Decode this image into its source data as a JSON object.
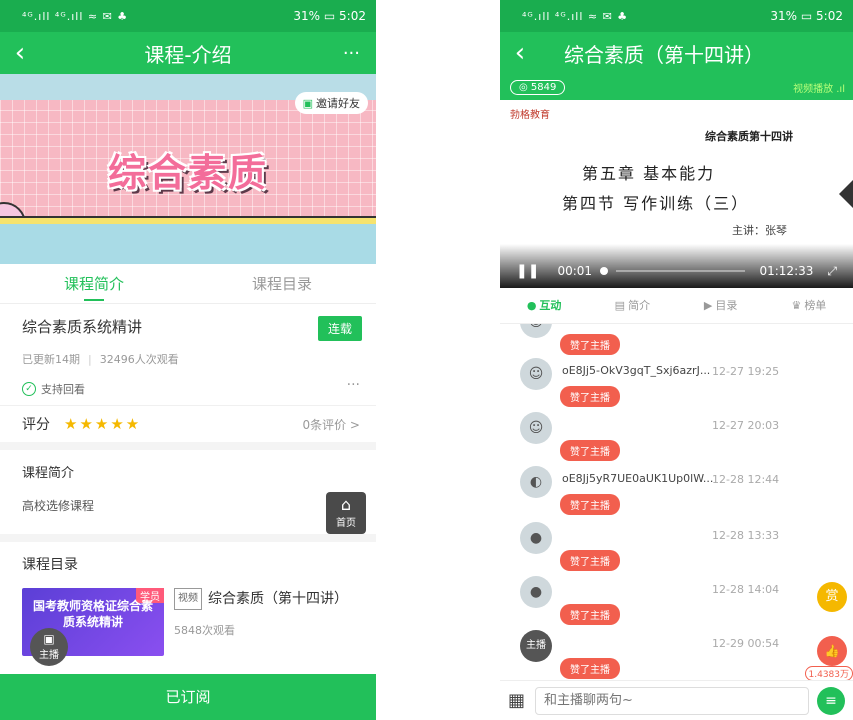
{
  "left": {
    "status": {
      "signal": "⁴ᴳ.ıll ⁴ᴳ.ıll ≈ ✉ ♣",
      "battery": "31%",
      "time": "5:02"
    },
    "nav": {
      "title": "课程-介绍",
      "more": "···"
    },
    "banner": {
      "title": "综合素质",
      "invite": "邀请好友"
    },
    "tabs": [
      "课程简介",
      "课程目录"
    ],
    "course": {
      "name": "综合素质系统精讲",
      "badge": "连载",
      "updated": "已更新14期",
      "views": "32496人次观看",
      "replay": "支持回看",
      "more": "···"
    },
    "rating": {
      "label": "评分",
      "stars": "★★★★★",
      "count": "0条评价 >"
    },
    "intro": {
      "heading": "课程简介",
      "text": "高校选修课程"
    },
    "home": {
      "label": "首页"
    },
    "catalog": {
      "heading": "课程目录",
      "lesson": {
        "thumb_tag": "学员",
        "thumb_title": "国考教师资格证综合素质系统精讲",
        "kind": "视频",
        "title": "综合素质（第十四讲）",
        "views": "5848次观看"
      }
    },
    "anchor": {
      "label": "主播"
    },
    "subscribe": "已订阅"
  },
  "right": {
    "status": {
      "signal": "⁴ᴳ.ıll ⁴ᴳ.ıll ≈ ✉ ♣",
      "battery": "31%",
      "time": "5:02"
    },
    "nav": {
      "title": "综合素质（第十四讲）"
    },
    "viewer_count": "◎ 5849",
    "play_mode": "视频播放 .ıl",
    "video": {
      "logo": "勃格教育",
      "slide_title": "综合素质第十四讲",
      "chapter": "第五章  基本能力",
      "section": "第四节  写作训练（三）",
      "lecturer": "主讲：张琴",
      "current": "00:01",
      "duration": "01:12:33"
    },
    "tabs": [
      {
        "icon": "●",
        "label": "互动"
      },
      {
        "icon": "▤",
        "label": "简介"
      },
      {
        "icon": "▶",
        "label": "目录"
      },
      {
        "icon": "♛",
        "label": "榜单"
      }
    ],
    "messages": [
      {
        "nick": "",
        "time": "",
        "like": "赞了主播",
        "avatar": "☺"
      },
      {
        "nick": "oE8Jj5-OkV3gqT_Sxj6azrJ...",
        "time": "12-27 19:25",
        "like": "赞了主播",
        "avatar": "☺"
      },
      {
        "nick": "",
        "time": "12-27 20:03",
        "like": "赞了主播",
        "avatar": "☺"
      },
      {
        "nick": "oE8Jj5yR7UE0aUK1Up0lW...",
        "time": "12-28 12:44",
        "like": "赞了主播",
        "avatar": "◐"
      },
      {
        "nick": "",
        "time": "12-28 13:33",
        "like": "赞了主播",
        "avatar": "●"
      },
      {
        "nick": "",
        "time": "12-28 14:04",
        "like": "赞了主播",
        "avatar": "●"
      },
      {
        "nick": "",
        "time": "12-29 00:54",
        "like": "赞了主播",
        "avatar": "主播"
      }
    ],
    "reward": "赏",
    "thumbs": "👍",
    "like_count": "1.4383万",
    "input_placeholder": "和主播聊两句~"
  }
}
